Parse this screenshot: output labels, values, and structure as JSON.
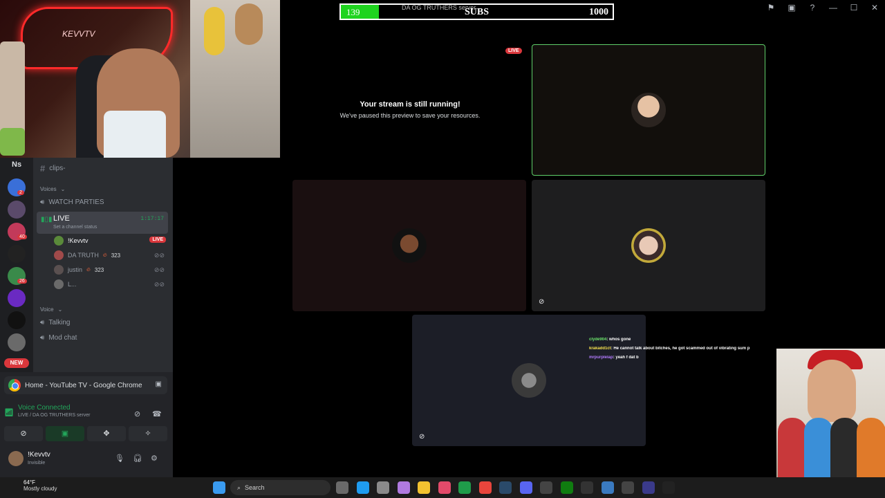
{
  "subs_goal": {
    "current": "139",
    "label": "SUBS",
    "target": "1000",
    "server_text": "DA OG TRUTHERS server",
    "progress_fraction": 0.139
  },
  "webcam": {
    "tag": "KEVVTV"
  },
  "servers": {
    "header": "Ns",
    "items": [
      {
        "icon": "server-avatar-icon",
        "badge": "2",
        "color": "#3a6fd8"
      },
      {
        "icon": "server-avatar-icon",
        "badge": "",
        "color": "#5a4a6a"
      },
      {
        "icon": "server-avatar-icon",
        "badge": "40",
        "color": "#c23a5a"
      },
      {
        "icon": "server-avatar-icon",
        "badge": "",
        "color": "#222222"
      },
      {
        "icon": "server-avatar-icon",
        "badge": "26",
        "color": "#3a8a4a"
      },
      {
        "icon": "server-avatar-icon",
        "badge": "",
        "color": "#6a2ac2"
      },
      {
        "icon": "server-avatar-icon",
        "badge": "",
        "color": "#111111"
      },
      {
        "icon": "server-avatar-icon",
        "badge": "",
        "color": "#6a6a6a"
      }
    ],
    "new_badge": "NEW"
  },
  "channels": {
    "top_channel": "clips-",
    "voices_category": "Voices",
    "watch_parties": "WATCH PARTIES",
    "live_channel": {
      "name": "LIVE",
      "status": "Set a channel status",
      "time": "1:17:17"
    },
    "members": [
      {
        "name": "!Kevvtv",
        "badge": "LIVE",
        "count": "",
        "active": true
      },
      {
        "name": "DA TRUTH",
        "badge": "",
        "count": "323",
        "active": false
      },
      {
        "name": "justin",
        "badge": "",
        "count": "323",
        "active": false
      },
      {
        "name": "L...",
        "badge": "",
        "count": "",
        "active": false
      }
    ],
    "voice_category": "Voice",
    "voice_channels": [
      "Talking",
      "Mod chat"
    ]
  },
  "share": {
    "title": "Home - YouTube TV - Google Chrome"
  },
  "voice": {
    "status": "Voice Connected",
    "server": "LIVE / DA OG TRUTHERS server"
  },
  "user": {
    "name": "!Kevvtv",
    "status": "Invisible"
  },
  "stage": {
    "paused_title": "Your stream is still running!",
    "paused_body": "We've paused this preview to save your resources.",
    "live_tag": "LIVE"
  },
  "chat": [
    {
      "user": "clyde904",
      "msg": ": whos gone"
    },
    {
      "user": "krakadd1ct",
      "msg": ": He cannot talk about bitches, he got scammed out of vibrating sum p"
    },
    {
      "user": "mrpurplelap",
      "msg": ": yeah f dat b"
    }
  ],
  "taskbar": {
    "temp": "64°F",
    "weather": "Mostly cloudy",
    "search_placeholder": "Search"
  },
  "colors": {
    "discord_green": "#23a55a",
    "discord_red": "#da373c",
    "sub_bar_fill": "#1fd41f"
  }
}
